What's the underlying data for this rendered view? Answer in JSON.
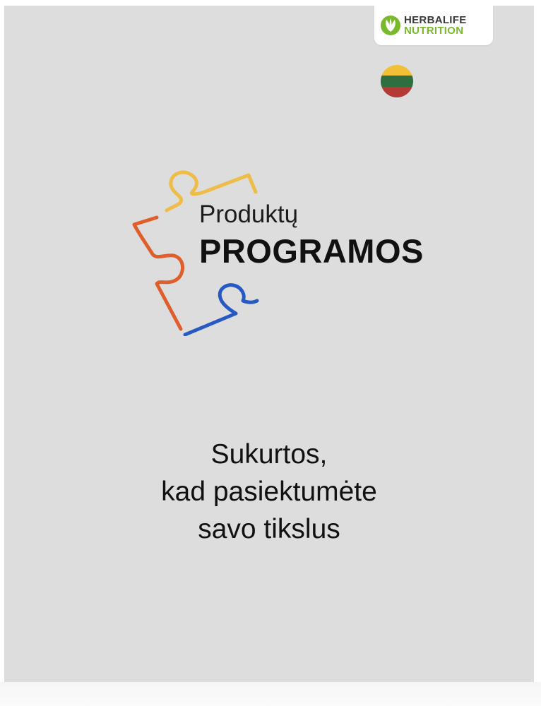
{
  "brand": {
    "line1": "HERBALIFE",
    "line2": "NUTRITION",
    "mark_icon": "herbalife-leaf-icon"
  },
  "flag": {
    "icon": "lithuania-flag-icon",
    "colors": [
      "#f2c037",
      "#2f6e3f",
      "#b43a35"
    ]
  },
  "logo": {
    "line1": "Produktų",
    "line2": "PROGRAMOS",
    "puzzle_colors": [
      "#eebd48",
      "#de5f2c",
      "#2659c4"
    ]
  },
  "tagline": {
    "lines": [
      "Sukurtos,",
      "kad pasiektumėte",
      "savo tikslus"
    ]
  },
  "colors": {
    "page_background": "#dddddd",
    "brand_green": "#7ab92b"
  }
}
